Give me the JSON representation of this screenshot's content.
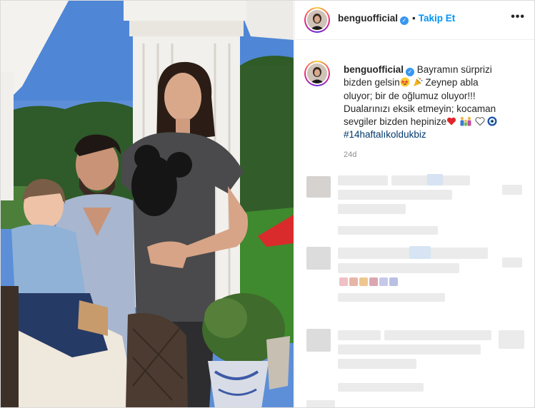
{
  "post": {
    "username": "benguofficial",
    "verified_mark": "✓",
    "separator": "•",
    "follow_label": "Takip Et",
    "more_label": "•••",
    "caption": {
      "line1": "Bayramın sürprizi",
      "line2a": "bizden gelsin",
      "line2b": "Zeynep abla",
      "line3": "oluyor; bir de oğlumuz oluyor!!!",
      "line4": "Dualarınızı eksik etmeyin; kocaman",
      "line5": "sevgiler bizden hepinize",
      "hashtag": "#14haftalıkoldukbiz"
    },
    "time_ago": "24d"
  },
  "colors": {
    "accent": "#0095f6",
    "verified": "#3897f0",
    "hashtag": "#00376b"
  },
  "icons": [
    "star-struck-emoji-icon",
    "party-popper-icon",
    "red-heart-icon",
    "family-icon",
    "white-heart-icon",
    "nazar-amulet-icon",
    "verified-icon",
    "more-options-icon"
  ]
}
